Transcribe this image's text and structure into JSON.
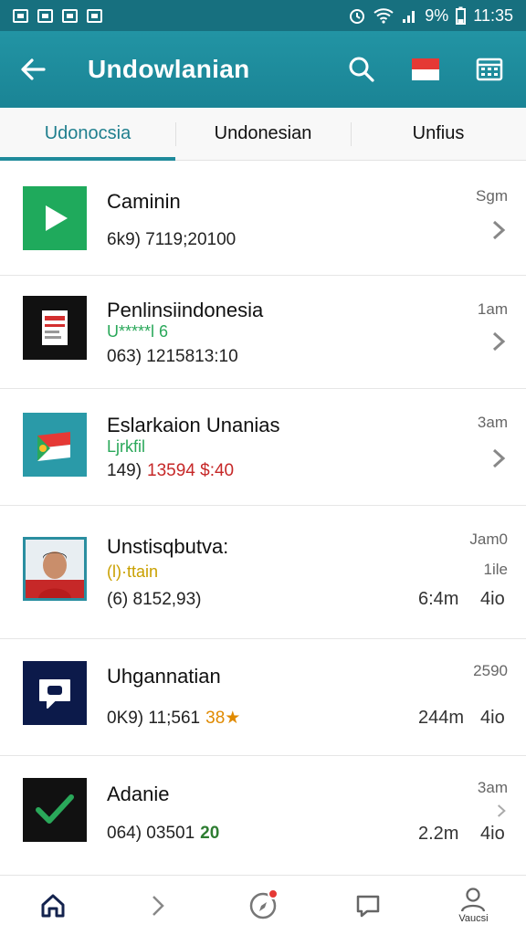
{
  "status_bar": {
    "battery": "9%",
    "time": "11:35"
  },
  "app_bar": {
    "title": "Undowlanian"
  },
  "tabs": [
    {
      "label": "Udonocsia",
      "active": true
    },
    {
      "label": "Undonesian",
      "active": false
    },
    {
      "label": "Unfius",
      "active": false
    }
  ],
  "items": [
    {
      "name": "Caminin",
      "sub": "",
      "number": "6k9) 7119;20100",
      "highlight": "",
      "time": "Sgm"
    },
    {
      "name": "Penlinsiindonesia",
      "sub": "U*****l 6",
      "number": "063) 1215813:10",
      "highlight": "",
      "time": "1am"
    },
    {
      "name": "Eslarkaion Unanias",
      "sub": "Ljrkfil",
      "number": "149)",
      "highlight": "13594 $:40",
      "time": "3am"
    },
    {
      "name": "Unstisqbutva:",
      "sub": "(l)·ttain",
      "number": "(6) 8152,93)",
      "highlight": "",
      "time": "Jam0",
      "time2": "1ile",
      "meta1": "6:4m",
      "meta2": "4io"
    },
    {
      "name": "Uhgannatian",
      "sub": "",
      "number": "0K9) 11;561",
      "highlight": "38",
      "time": "2590",
      "meta1": "244m",
      "meta2": "4io"
    },
    {
      "name": "Adanie",
      "sub": "",
      "number": "064) 03501",
      "highlight": "20",
      "time": "3am",
      "meta1": "2.2m",
      "meta2": "4io"
    }
  ],
  "bottom_nav": {
    "profile_label": "Vaucsi"
  },
  "colors": {
    "primary": "#1a8495",
    "status": "#17707f",
    "green": "#2aa85a",
    "red": "#c62828",
    "orange": "#e08a00"
  }
}
